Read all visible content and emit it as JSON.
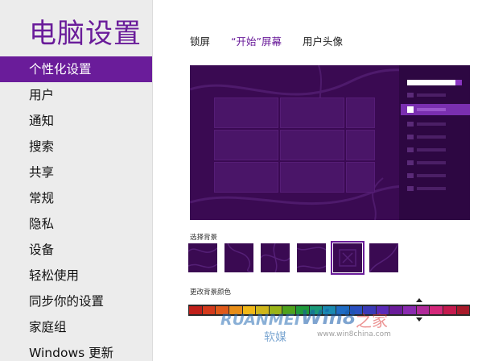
{
  "sidebar": {
    "title": "电脑设置",
    "items": [
      {
        "label": "个性化设置",
        "active": true
      },
      {
        "label": "用户"
      },
      {
        "label": "通知"
      },
      {
        "label": "搜索"
      },
      {
        "label": "共享"
      },
      {
        "label": "常规"
      },
      {
        "label": "隐私"
      },
      {
        "label": "设备"
      },
      {
        "label": "轻松使用"
      },
      {
        "label": "同步你的设置"
      },
      {
        "label": "家庭组"
      },
      {
        "label": "Windows 更新"
      }
    ]
  },
  "tabs": [
    {
      "label": "锁屏"
    },
    {
      "label": "“开始”屏幕",
      "active": true
    },
    {
      "label": "用户头像"
    }
  ],
  "background": {
    "label": "选择背景",
    "selected_index": 4,
    "option_count": 6
  },
  "color": {
    "label": "更改背景颜色",
    "selected_index": 15,
    "swatches": [
      "#c0201a",
      "#d43a1c",
      "#e05a1a",
      "#e88e18",
      "#f0b818",
      "#cfb61a",
      "#9ab418",
      "#4fa21c",
      "#1f9a3a",
      "#1a9a78",
      "#1a8ab0",
      "#1f6cc4",
      "#2a4fc0",
      "#3a3ab8",
      "#5a2ab8",
      "#6a1c9a",
      "#8a2ab0",
      "#b02a9a",
      "#d4287a",
      "#c41a4e",
      "#a81a2a"
    ]
  },
  "watermark": {
    "brand_en": "RUANMEI",
    "brand_cn": "软媒",
    "site": "Win8",
    "site_suffix": "之家",
    "url": "www.win8china.com"
  },
  "theme": {
    "accent": "#6a1c9a",
    "start_bg": "#3a0a52"
  }
}
